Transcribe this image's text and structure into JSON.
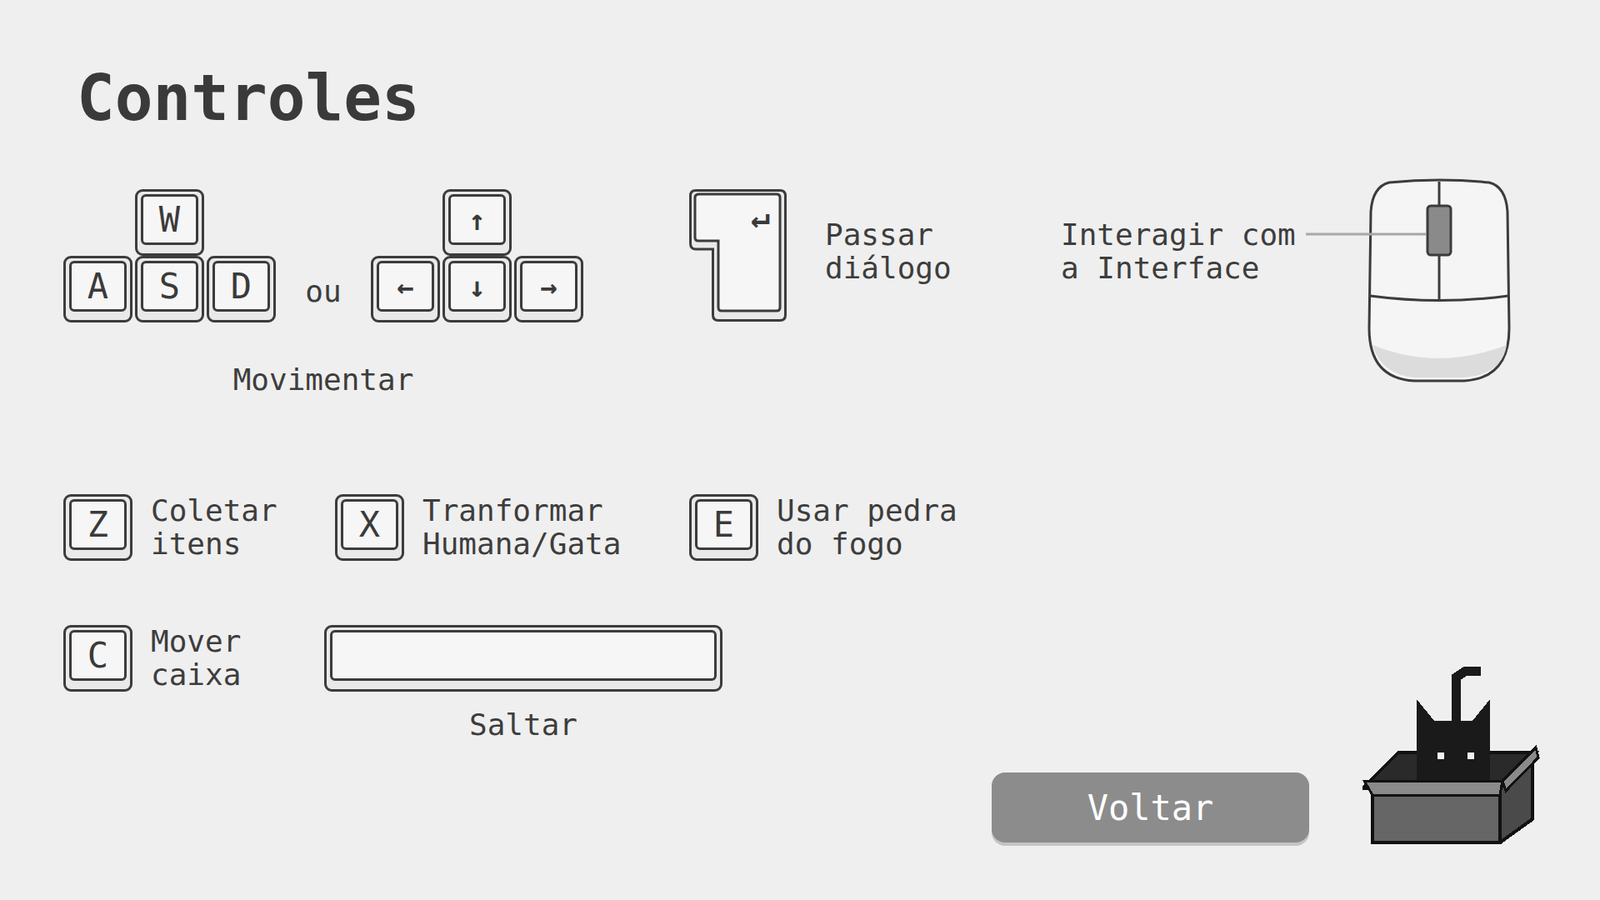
{
  "title": "Controles",
  "movement": {
    "wasd": [
      "W",
      "A",
      "S",
      "D"
    ],
    "separator": "ou",
    "arrows": [
      "↑",
      "←",
      "↓",
      "→"
    ],
    "label": "Movimentar"
  },
  "dialog": {
    "key": "↵",
    "label": [
      "Passar",
      "diálogo"
    ]
  },
  "mouse": {
    "label": [
      "Interagir com",
      "a Interface"
    ]
  },
  "actions": [
    {
      "key": "Z",
      "label": [
        "Coletar",
        "itens"
      ]
    },
    {
      "key": "X",
      "label": [
        "Tranformar",
        "Humana/Gata"
      ]
    },
    {
      "key": "E",
      "label": [
        "Usar pedra",
        "do fogo"
      ]
    }
  ],
  "box_action": {
    "key": "C",
    "label": [
      "Mover",
      "caixa"
    ]
  },
  "jump": {
    "label": "Saltar"
  },
  "buttons": [
    "Voltar"
  ]
}
